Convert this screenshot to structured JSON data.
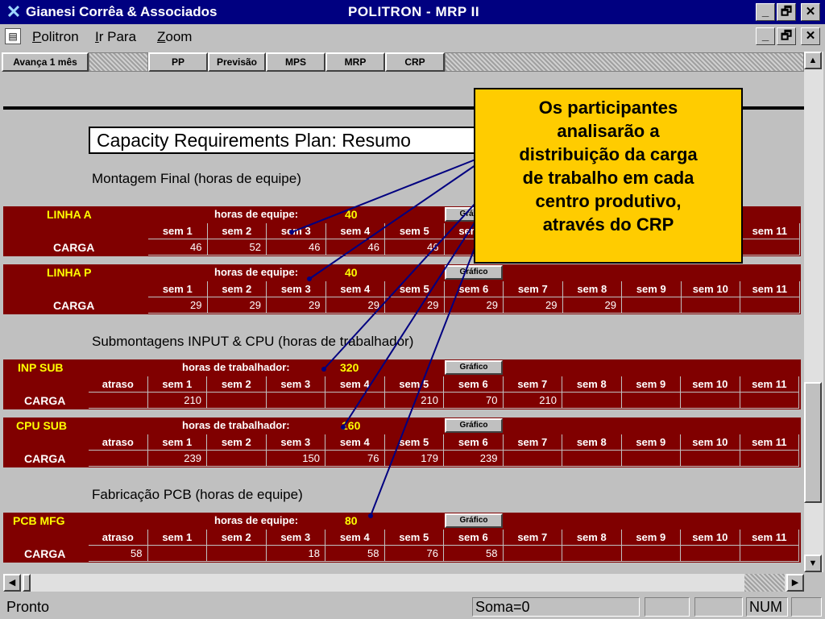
{
  "window": {
    "company": "Gianesi Corrêa & Associados",
    "title": "POLITRON - MRP II",
    "min": "_",
    "max": "🗗",
    "close": "✕"
  },
  "menu": {
    "items": [
      {
        "label": "Politron",
        "underline": "P",
        "rest": "olitron"
      },
      {
        "label": "Ir Para",
        "underline": "I",
        "rest": "r Para"
      },
      {
        "label": "Zoom",
        "underline": "Z",
        "rest": "oom"
      }
    ]
  },
  "toolbar": {
    "advance": "Avança 1 mês",
    "pp": "PP",
    "previsao": "Previsão",
    "mps": "MPS",
    "mrp": "MRP",
    "crp": "CRP"
  },
  "sheet": {
    "heading": "Capacity Requirements Plan: Resumo",
    "sections": {
      "montagem": "Montagem Final (horas de equipe)",
      "submontagens": "Submontagens INPUT & CPU (horas de trabalhador)",
      "fabricacao": "Fabricação PCB (horas de equipe)"
    },
    "grafico_label": "Gráfico",
    "carga_label": "CARGA",
    "atraso_label": "atraso",
    "weeks": [
      "sem 1",
      "sem 2",
      "sem 3",
      "sem 4",
      "sem 5",
      "sem 6",
      "sem 7",
      "sem 8",
      "sem 9",
      "sem 10",
      "sem 11"
    ],
    "blocks": {
      "linha_a": {
        "name": "LINHA A",
        "hours_label": "horas de equipe:",
        "hours": "40",
        "carga": [
          "46",
          "52",
          "46",
          "46",
          "46",
          "",
          "",
          "",
          "",
          "",
          ""
        ]
      },
      "linha_p": {
        "name": "LINHA P",
        "hours_label": "horas de equipe:",
        "hours": "40",
        "carga": [
          "29",
          "29",
          "29",
          "29",
          "29",
          "29",
          "29",
          "29",
          "",
          "",
          ""
        ]
      },
      "inp_sub": {
        "name": "INP SUB",
        "hours_label": "horas de trabalhador:",
        "hours": "320",
        "atraso": "",
        "carga": [
          "210",
          "",
          "",
          "",
          "210",
          "70",
          "210",
          "",
          "",
          "",
          ""
        ]
      },
      "cpu_sub": {
        "name": "CPU SUB",
        "hours_label": "horas de trabalhador:",
        "hours": "160",
        "atraso": "",
        "carga": [
          "239",
          "",
          "150",
          "76",
          "179",
          "239",
          "",
          "",
          "",
          "",
          ""
        ]
      },
      "pcb_mfg": {
        "name": "PCB MFG",
        "hours_label": "horas de equipe:",
        "hours": "80",
        "atraso": "58",
        "carga": [
          "",
          "",
          "18",
          "58",
          "76",
          "58",
          "",
          "",
          "",
          "",
          ""
        ]
      }
    }
  },
  "callout": {
    "lines": [
      "Os participantes",
      "analisarão a",
      "distribuição da carga",
      "de trabalho em cada",
      "centro produtivo,",
      "através do CRP"
    ]
  },
  "status": {
    "ready": "Pronto",
    "sum": "Soma=0",
    "num": "NUM"
  },
  "colors": {
    "title_bar": "#000080",
    "band": "#800000",
    "label_yellow": "#ffff00",
    "callout": "#ffcc00",
    "arrow": "#000080"
  }
}
